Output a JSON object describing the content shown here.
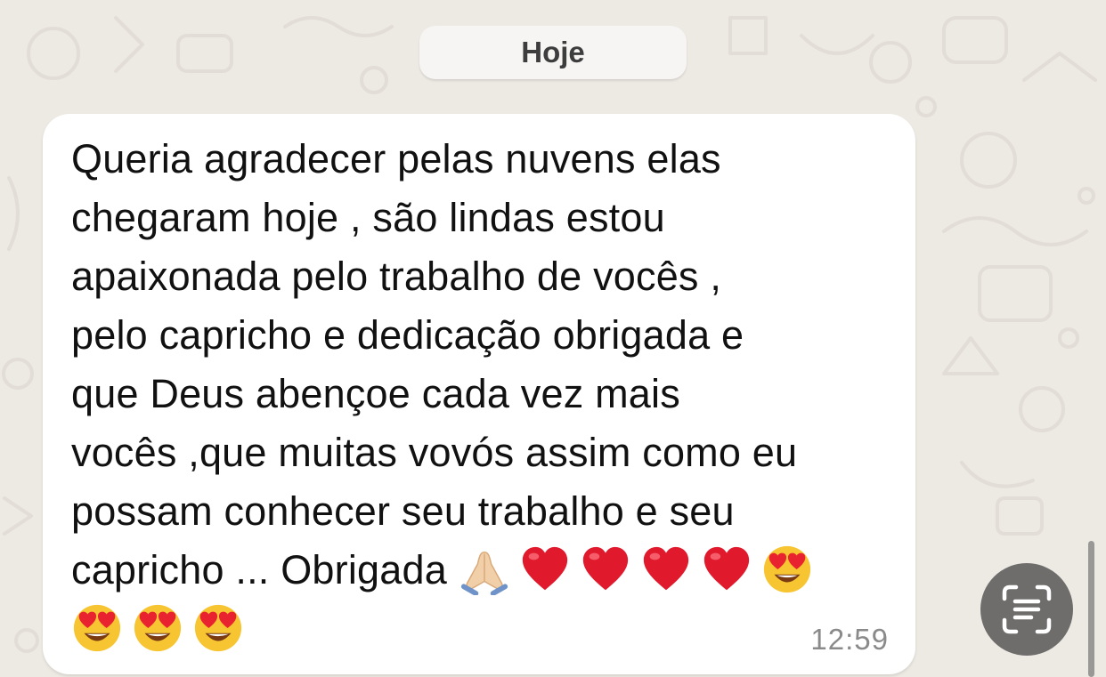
{
  "date_separator": "Hoje",
  "message": {
    "text": "Queria agradecer pelas nuvens elas\nchegaram hoje , são lindas estou\napaixonada pelo trabalho de vocês ,\npelo capricho e dedicação obrigada e\nque Deus abençoe cada vez mais\nvocês ,que muitas vovós assim como eu\npossam conhecer seu trabalho e seu\ncapricho ... Obrigada",
    "emojis_line1": [
      "folded-hands-icon",
      "red-heart-icon",
      "red-heart-icon",
      "red-heart-icon",
      "red-heart-icon",
      "heart-eyes-face-icon"
    ],
    "emojis_line2": [
      "heart-eyes-face-icon",
      "heart-eyes-face-icon",
      "heart-eyes-face-icon"
    ],
    "time": "12:59"
  },
  "scan_button": {
    "icon": "live-text-scan-icon"
  },
  "colors": {
    "background": "#ede9e3",
    "bubble": "#ffffff",
    "date_pill": "#f6f5f3",
    "scan_button": "#6e6d6c",
    "heart": "#e0192c"
  }
}
